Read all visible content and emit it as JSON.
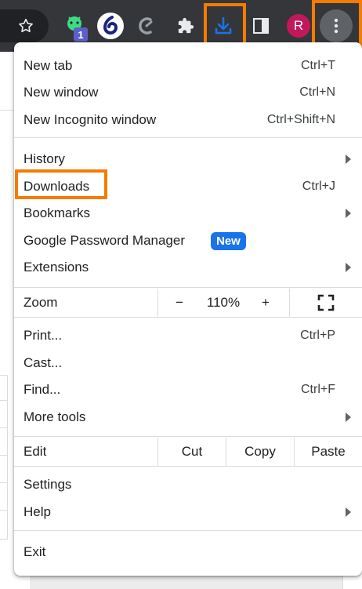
{
  "toolbar": {
    "icons": [
      "star-icon",
      "android-extension-icon",
      "dolphin-extension-icon",
      "crescent-extension-icon",
      "puzzle-extensions-icon",
      "download-icon",
      "side-panel-icon",
      "profile-avatar",
      "more-menu-icon"
    ],
    "extension_badge": "1",
    "avatar_letter": "R",
    "accent_download": "#1a73e8",
    "highlight_color": "#f57c00"
  },
  "menu": {
    "new_tab": {
      "label": "New tab",
      "shortcut": "Ctrl+T"
    },
    "new_window": {
      "label": "New window",
      "shortcut": "Ctrl+N"
    },
    "new_incognito": {
      "label": "New Incognito window",
      "shortcut": "Ctrl+Shift+N"
    },
    "history": {
      "label": "History"
    },
    "downloads": {
      "label": "Downloads",
      "shortcut": "Ctrl+J"
    },
    "bookmarks": {
      "label": "Bookmarks"
    },
    "password_manager": {
      "label": "Google Password Manager",
      "badge": "New"
    },
    "extensions": {
      "label": "Extensions"
    },
    "zoom": {
      "label": "Zoom",
      "minus": "−",
      "value": "110%",
      "plus": "+"
    },
    "print": {
      "label": "Print...",
      "shortcut": "Ctrl+P"
    },
    "cast": {
      "label": "Cast..."
    },
    "find": {
      "label": "Find...",
      "shortcut": "Ctrl+F"
    },
    "more_tools": {
      "label": "More tools"
    },
    "edit": {
      "label": "Edit",
      "cut": "Cut",
      "copy": "Copy",
      "paste": "Paste"
    },
    "settings": {
      "label": "Settings"
    },
    "help": {
      "label": "Help"
    },
    "exit": {
      "label": "Exit"
    }
  }
}
